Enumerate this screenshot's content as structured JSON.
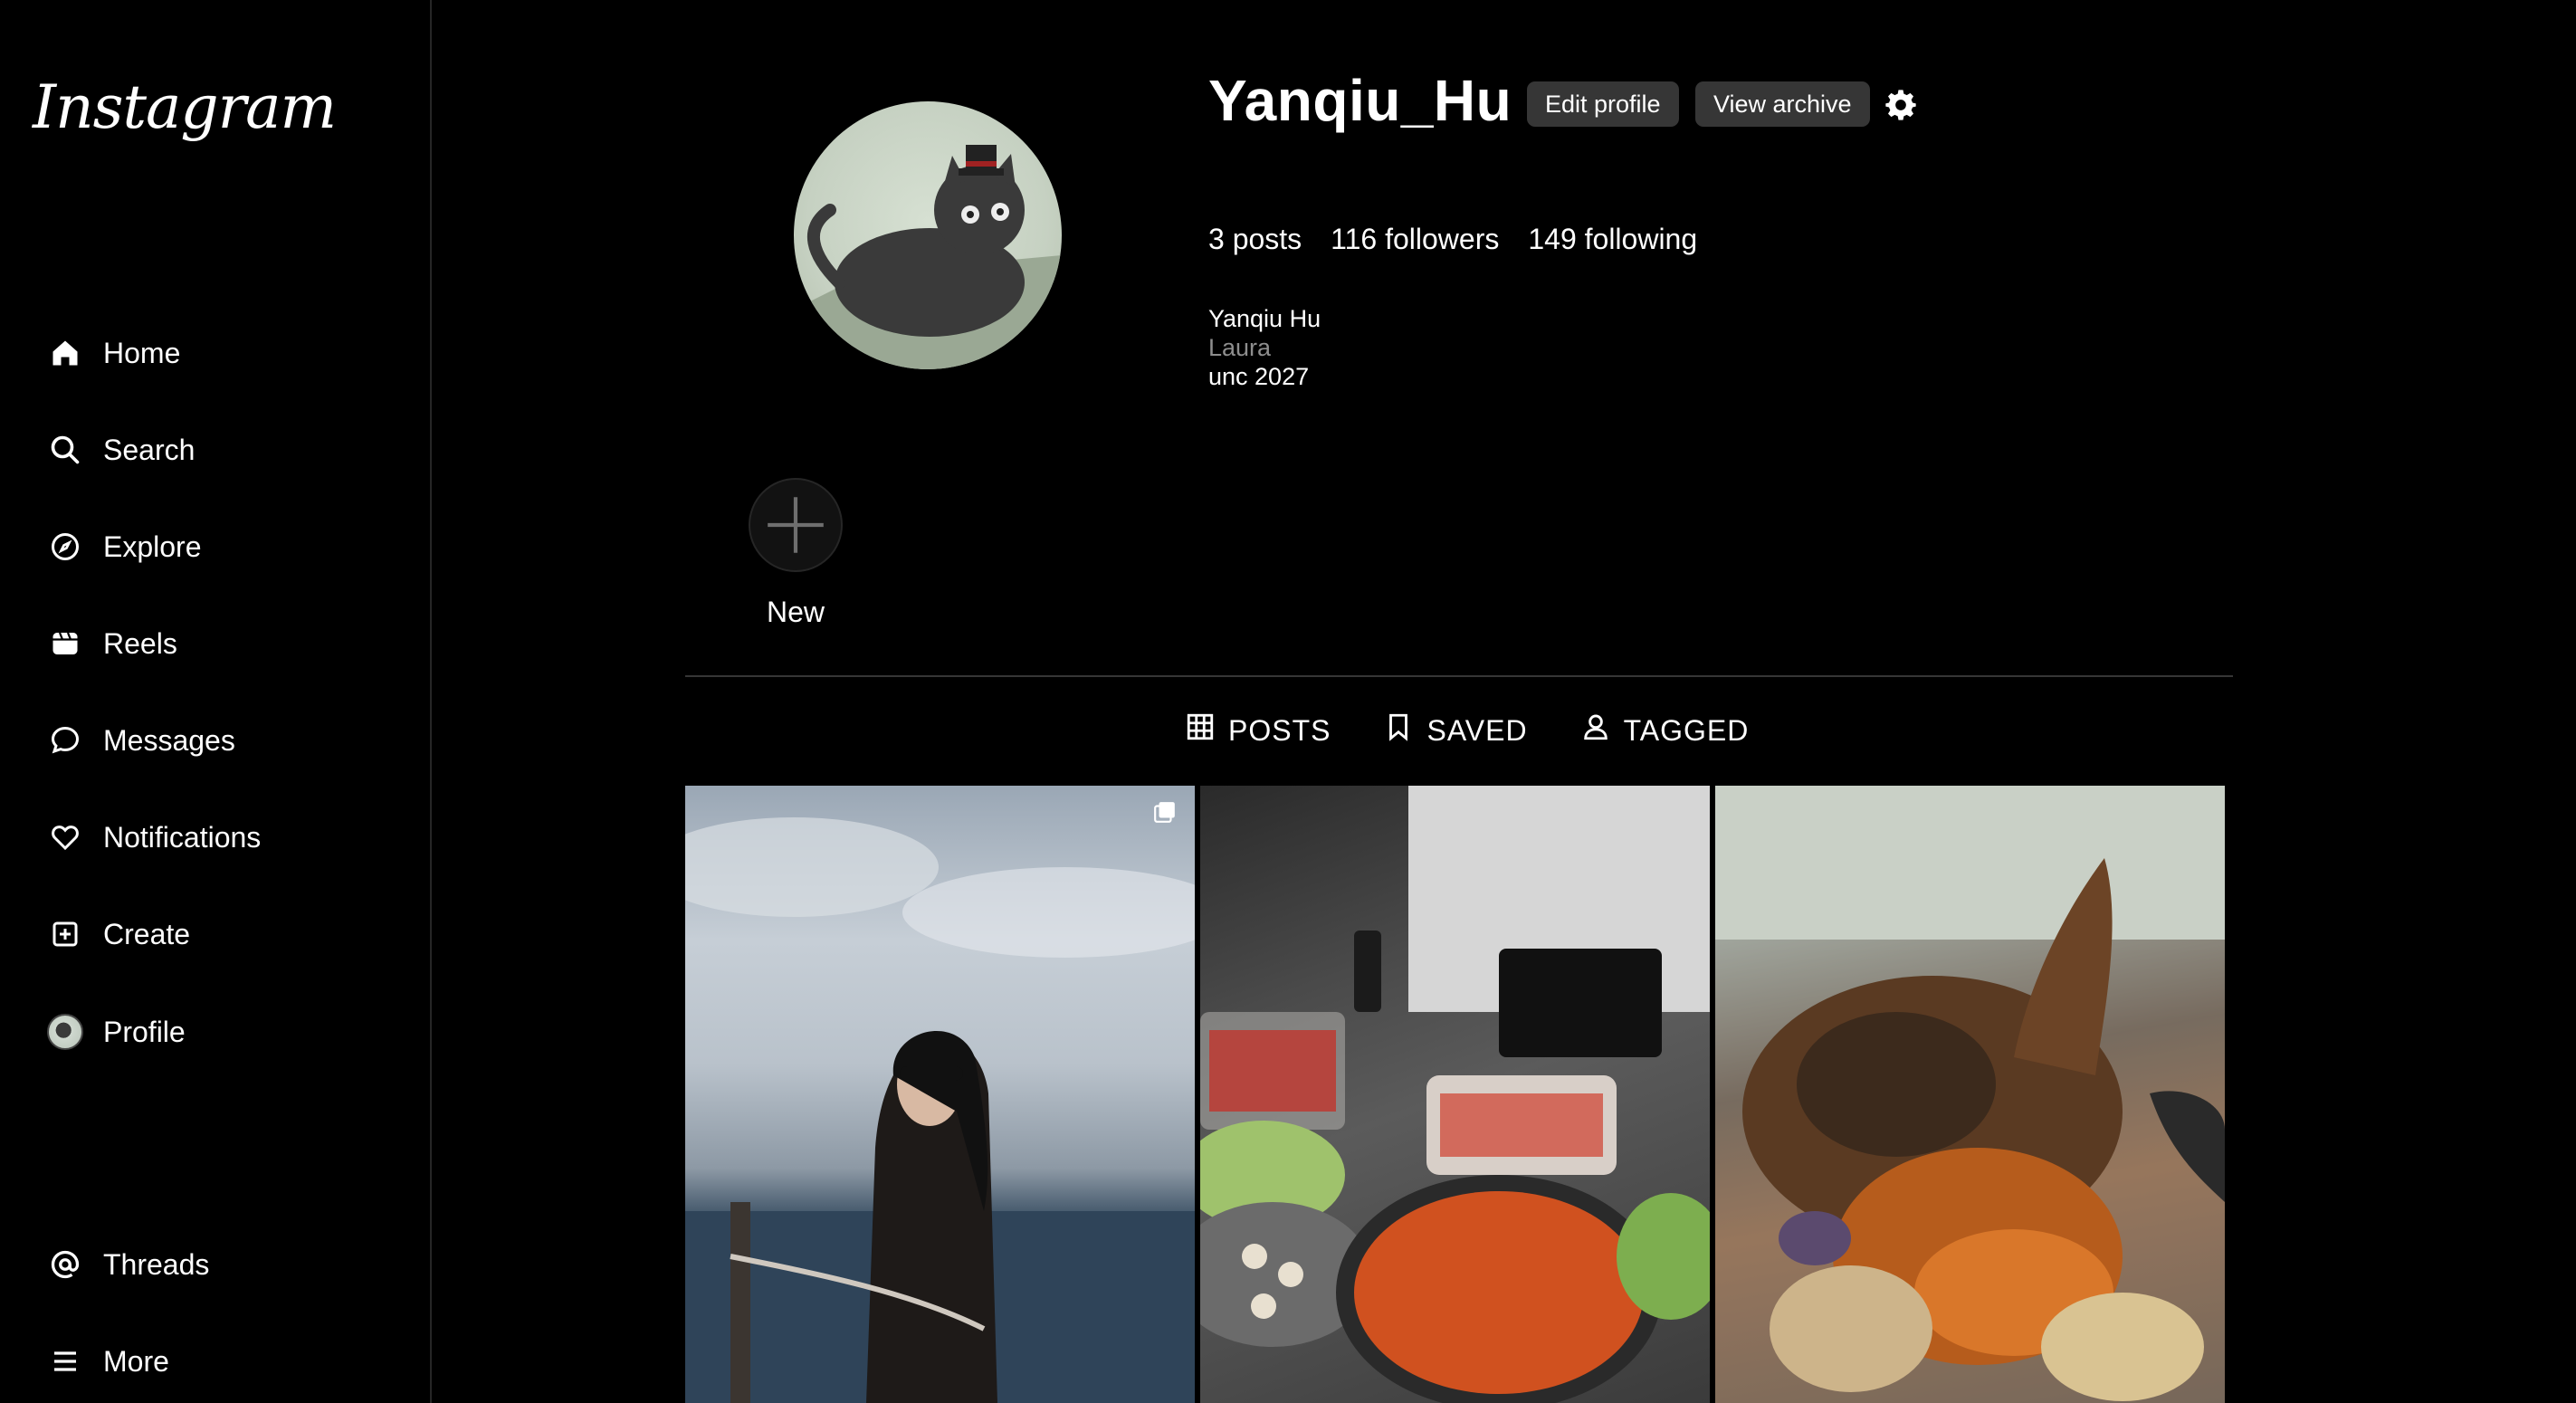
{
  "app": {
    "logo": "Instagram"
  },
  "sidebar": {
    "items": [
      {
        "label": "Home",
        "icon": "home-icon"
      },
      {
        "label": "Search",
        "icon": "search-icon"
      },
      {
        "label": "Explore",
        "icon": "compass-icon"
      },
      {
        "label": "Reels",
        "icon": "reels-icon"
      },
      {
        "label": "Messages",
        "icon": "message-icon"
      },
      {
        "label": "Notifications",
        "icon": "heart-icon"
      },
      {
        "label": "Create",
        "icon": "plus-square-icon"
      },
      {
        "label": "Profile",
        "icon": "avatar"
      },
      {
        "label": "Threads",
        "icon": "threads-icon"
      },
      {
        "label": "More",
        "icon": "menu-icon"
      }
    ]
  },
  "profile": {
    "username": "Yanqiu_Hu",
    "edit_label": "Edit profile",
    "archive_label": "View archive",
    "stats": {
      "posts": "3 posts",
      "followers": "116 followers",
      "following": "149 following"
    },
    "bio": {
      "name": "Yanqiu Hu",
      "pronouns": "Laura",
      "line": "unc 2027"
    }
  },
  "highlights": {
    "new_label": "New"
  },
  "tabs": [
    {
      "label": "POSTS",
      "icon": "grid-icon"
    },
    {
      "label": "SAVED",
      "icon": "bookmark-icon"
    },
    {
      "label": "TAGGED",
      "icon": "person-icon"
    }
  ],
  "colors": {
    "background": "#000000",
    "button": "#363636",
    "muted": "#8e8e8e",
    "divider": "#363636"
  }
}
